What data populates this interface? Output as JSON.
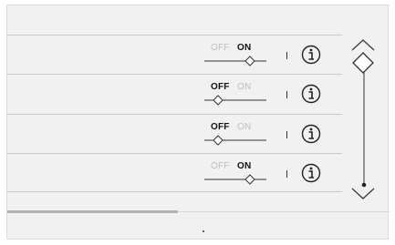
{
  "toggle_rows": [
    {
      "off_label": "OFF",
      "on_label": "ON",
      "state": "on"
    },
    {
      "off_label": "OFF",
      "on_label": "ON",
      "state": "off"
    },
    {
      "off_label": "OFF",
      "on_label": "ON",
      "state": "off"
    },
    {
      "off_label": "OFF",
      "on_label": "ON",
      "state": "on"
    }
  ],
  "icons": {
    "info": "info-circle-icon",
    "scroll_up": "chevron-up-icon",
    "scroll_down": "chevron-down-icon",
    "thumb": "diamond-thumb-icon"
  },
  "colors": {
    "panel_bg": "#f1f1f1",
    "separator": "#c9c9c9",
    "active_text": "#111111",
    "inactive_text": "#bdbdbd"
  }
}
